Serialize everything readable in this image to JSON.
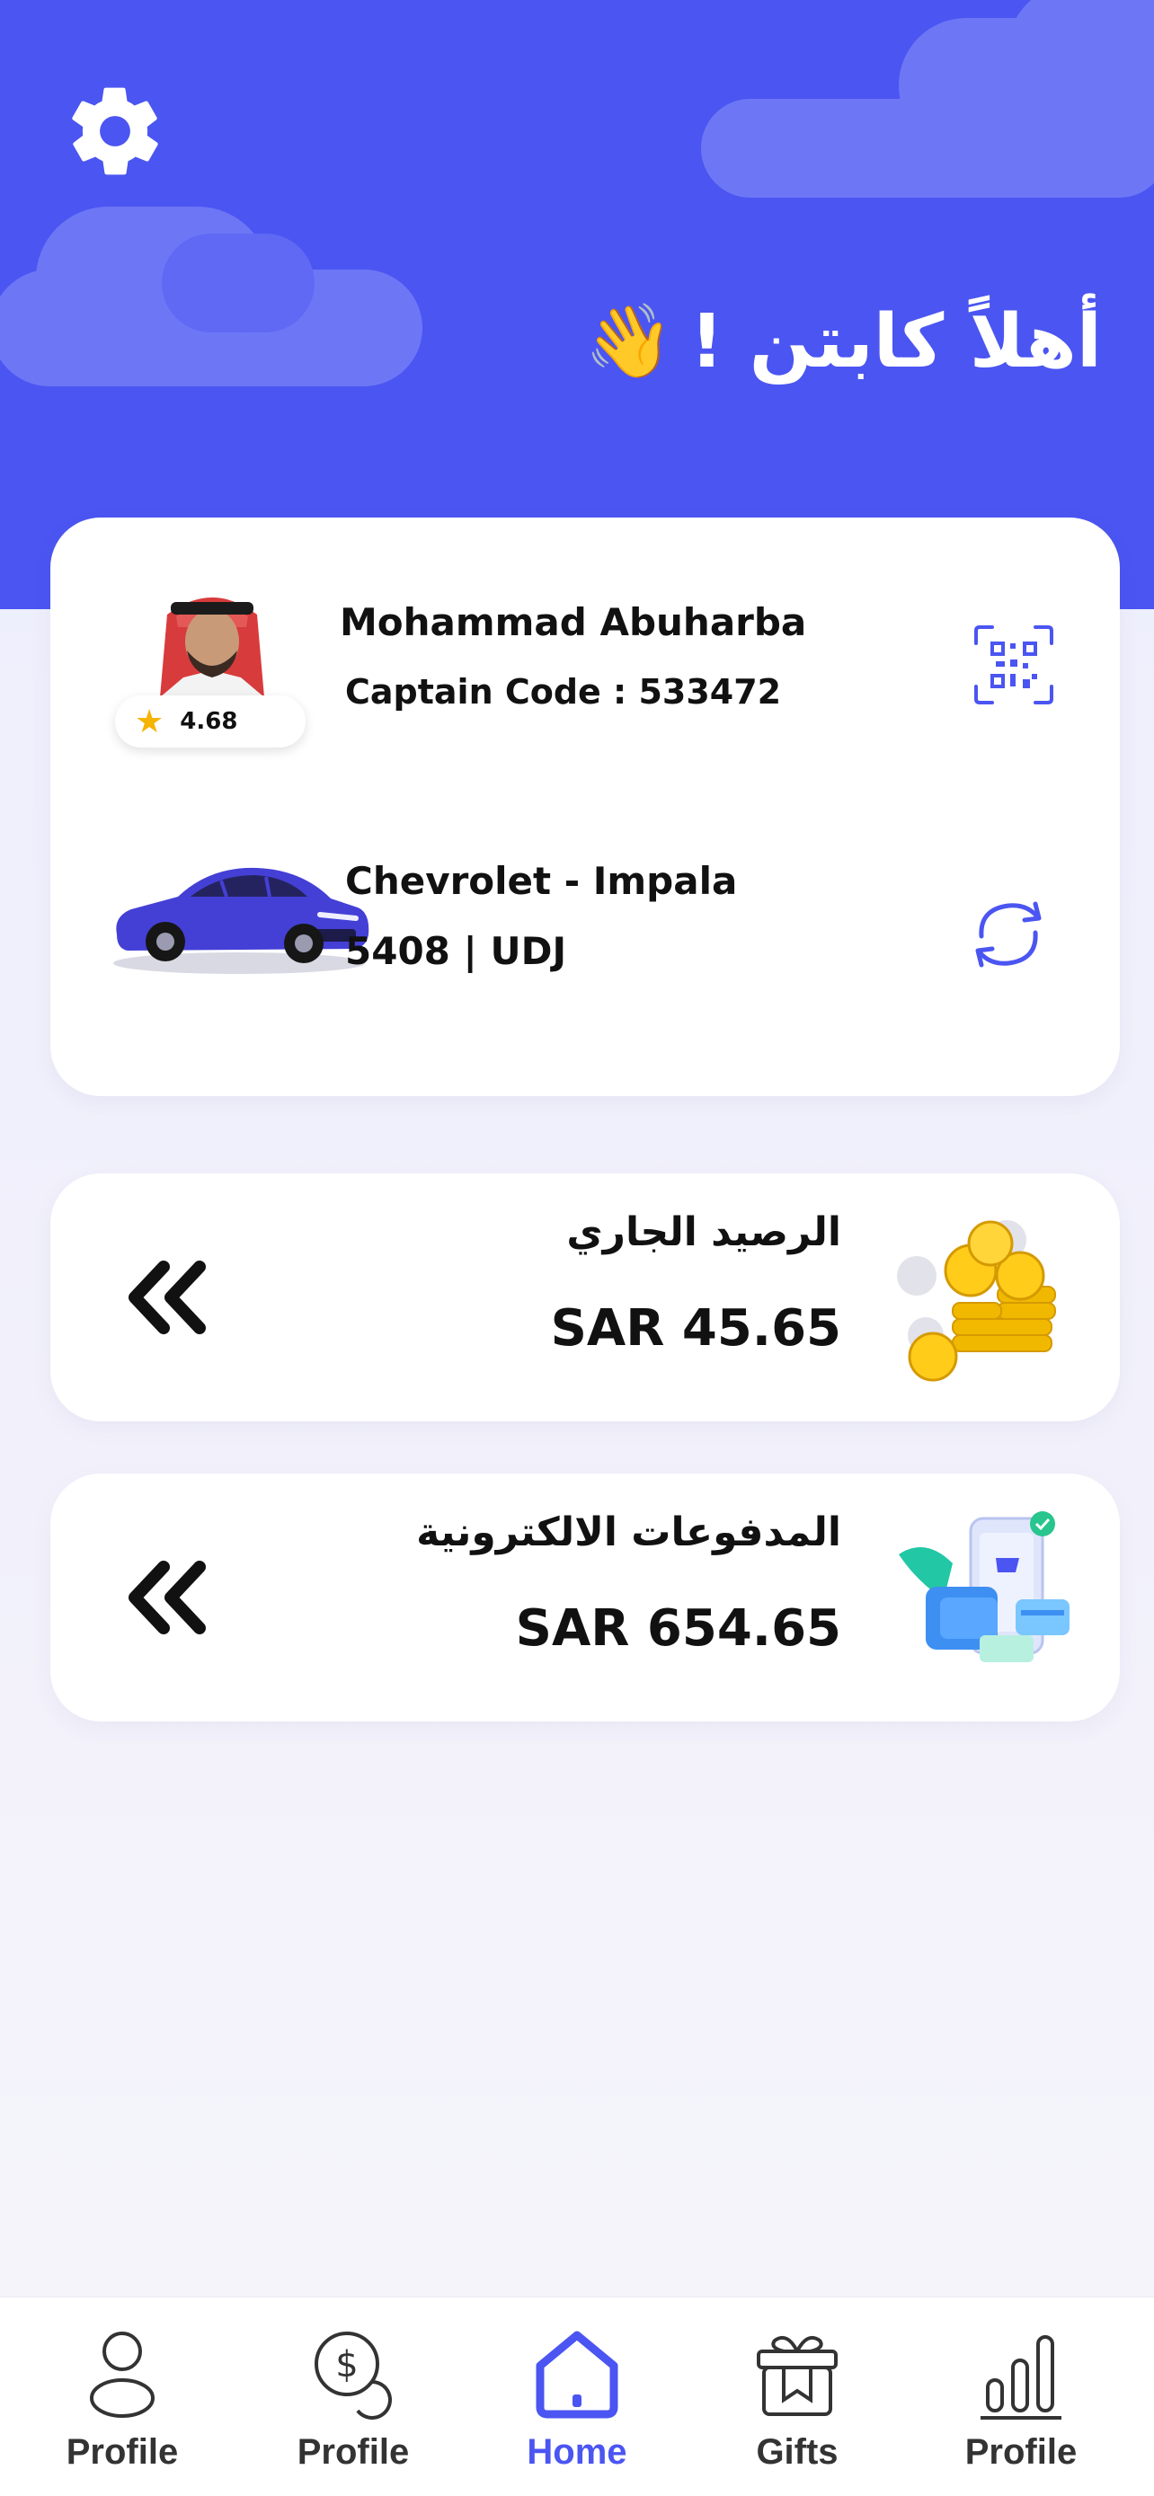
{
  "header": {
    "greeting": "أهلاً كابتن !",
    "greeting_emoji": "👋",
    "settings_icon": "gear-icon"
  },
  "colors": {
    "primary": "#4b55f1",
    "cloud": "#6d77f6",
    "background": "#f0f0fb",
    "star": "#f5b400",
    "text": "#111111"
  },
  "profile": {
    "name": "Mohammad Abuharba",
    "captain_code": "Captain Code : 533472",
    "rating": "4.68",
    "qr_icon": "qr-code-icon"
  },
  "vehicle": {
    "model": "Chevrolet - Impala",
    "plate": "5408 | UDJ",
    "swap_icon": "refresh-icon"
  },
  "balance": {
    "title": "الرصيد الجاري",
    "amount": "SAR 45.65",
    "icon": "double-chevron-left-icon"
  },
  "payments": {
    "title": "المدفوعات الالكترونية",
    "amount": "SAR 654.65",
    "icon": "double-chevron-left-icon"
  },
  "nav": {
    "items": [
      {
        "label": "Profile",
        "icon": "user-icon",
        "active": false
      },
      {
        "label": "Profile",
        "icon": "dollar-coin-icon",
        "active": false
      },
      {
        "label": "Home",
        "icon": "home-icon",
        "active": true
      },
      {
        "label": "Gifts",
        "icon": "gift-icon",
        "active": false
      },
      {
        "label": "Profile",
        "icon": "bar-chart-icon",
        "active": false
      }
    ]
  }
}
